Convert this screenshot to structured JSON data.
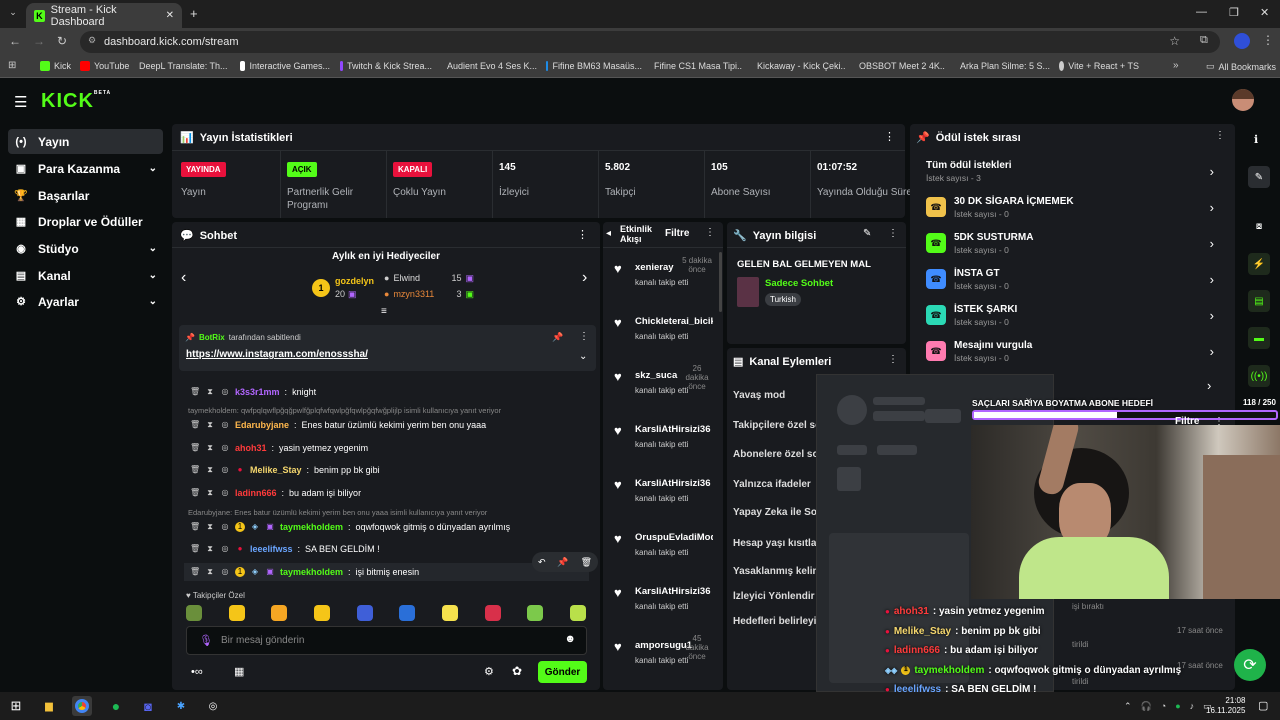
{
  "browser": {
    "tab_title": "Stream - Kick Dashboard",
    "url": "dashboard.kick.com/stream",
    "bookmarks": [
      "Kick",
      "YouTube",
      "DeepL Translate: Th...",
      "Interactive Games...",
      "Twitch & Kick Strea...",
      "Audient Evo 4 Ses K...",
      "Fifine BM63 Masaüs...",
      "Fifine CS1 Masa Tipi...",
      "Kickaway - Kick Çeki...",
      "OBSBOT Meet 2 4K...",
      "Arka Plan Silme: 5 S...",
      "Vite + React + TS"
    ],
    "all_bookmarks": "All Bookmarks"
  },
  "kick": {
    "logo": "KICK",
    "beta": "BETA"
  },
  "nav": [
    {
      "label": "Yayın",
      "icon": "(•)"
    },
    {
      "label": "Para Kazanma",
      "icon": "▣"
    },
    {
      "label": "Başarılar",
      "icon": "🏆"
    },
    {
      "label": "Droplar ve Ödüller",
      "icon": "▦"
    },
    {
      "label": "Stüdyo",
      "icon": "◉"
    },
    {
      "label": "Kanal",
      "icon": "▤"
    },
    {
      "label": "Ayarlar",
      "icon": "⚙"
    }
  ],
  "stats": {
    "title": "Yayın İstatistikleri",
    "items": [
      {
        "badge": "YAYINDA",
        "badge_color": "#e9113c",
        "label": "Yayın"
      },
      {
        "badge": "AÇIK",
        "badge_color": "#53fc18",
        "label": "Partnerlik Gelir Programı"
      },
      {
        "badge": "KAPALI",
        "badge_color": "#e9113c",
        "label": "Çoklu Yayın"
      },
      {
        "value": "145",
        "label": "İzleyici"
      },
      {
        "value": "5.802",
        "label": "Takipçi"
      },
      {
        "value": "105",
        "label": "Abone Sayısı"
      },
      {
        "value": "01:07:52",
        "label": "Yayında Olduğu Süre"
      }
    ]
  },
  "chat": {
    "title": "Sohbet",
    "gifters_title": "Aylık en iyi Hediyeciler",
    "top_gifter": {
      "name": "gozdelyn",
      "count": "20"
    },
    "gifters": [
      {
        "name": "Elwind",
        "count": "15"
      },
      {
        "name": "mzyn3311",
        "count": "3"
      }
    ],
    "pinned_by": "BotRix",
    "pinned_suffix": "tarafından sabitlendi",
    "pinned_link": "https://www.instagram.com/enosssha/",
    "messages": [
      {
        "user": "k3s3r1mm",
        "color": "#b266ff",
        "text": "knight"
      },
      {
        "reply": "taymekholdem: qwfpqlqwflpğqğpwlfğplqfwfqwlpğfqwlpğqfwğplijlp isimli kullanıcıya yanıt veriyor"
      },
      {
        "user": "Edarubyjane",
        "color": "#ffb84d",
        "text": "Enes batur üzümlü kekimi yerim ben onu yaaa"
      },
      {
        "user": "ahoh31",
        "color": "#ff3b3b",
        "text": "yasin yetmez yegenim"
      },
      {
        "user": "Melike_Stay",
        "color": "#f5d76e",
        "text": "benim pp bk gibi"
      },
      {
        "user": "ladinn666",
        "color": "#ff3b3b",
        "text": "bu adam işi biliyor"
      },
      {
        "reply": "Edarubyjane: Enes batur üzümlü kekimi yerim ben onu yaaa isimli kullanıcıya yanıt veriyor"
      },
      {
        "user": "taymekholdem",
        "color": "#53fc18",
        "text": "oqwfoqwok gitmiş o dünyadan ayrılmış"
      },
      {
        "user": "leeelifwss",
        "color": "#6aa5ff",
        "text": "SA BEN GELDİM !"
      },
      {
        "user": "taymekholdem",
        "color": "#53fc18",
        "text": "işi bitmiş enesin"
      }
    ],
    "emote_section": "Takipçiler Özel",
    "input_placeholder": "Bir mesaj gönderin",
    "send": "Gönder"
  },
  "activity": {
    "title": "Etkinlik Akışı",
    "filter": "Filtre",
    "items": [
      {
        "name": "xenieray",
        "sub": "kanalı takip etti",
        "time": "5 dakika önce"
      },
      {
        "name": "Chickleterai_bicik",
        "sub": "kanalı takip etti",
        "time": ""
      },
      {
        "name": "skz_suca",
        "sub": "kanalı takip etti",
        "time": "26 dakika önce"
      },
      {
        "name": "KarsliAtHirsizi36",
        "sub": "kanalı takip etti",
        "time": ""
      },
      {
        "name": "KarsliAtHirsizi36",
        "sub": "kanalı takip etti",
        "time": ""
      },
      {
        "name": "OruspuEvladiMod",
        "sub": "kanalı takip etti",
        "time": ""
      },
      {
        "name": "KarsliAtHirsizi36",
        "sub": "kanalı takip etti",
        "time": ""
      },
      {
        "name": "amporsugu1",
        "sub": "kanalı takip etti",
        "time": "45 dakika önce"
      }
    ]
  },
  "stream_info": {
    "title": "Yayın bilgisi",
    "stream_title": "GELEN BAL GELMEYEN MAL",
    "category": "Sadece Sohbet",
    "tag": "Turkish"
  },
  "channel_actions": {
    "title": "Kanal Eylemleri",
    "items": [
      "Yavaş mod",
      "Takipçilere özel sohbet",
      "Abonelere özel sohbet",
      "Yalnızca ifadeler",
      "Yapay Zeka ile Sohbet",
      "Hesap yaşı kısıtlaması",
      "Yasaklanmış kelimeler",
      "İzleyici Yönlendir",
      "Hedefleri belirleyin"
    ]
  },
  "rewards": {
    "title": "Ödül istek sırası",
    "items": [
      {
        "name": "Tüm ödül istekleri",
        "sub": "İstek sayısı - 3",
        "color": ""
      },
      {
        "name": "30 DK SİGARA İÇMEMEK",
        "sub": "İstek sayısı - 0",
        "color": "#f0c24b"
      },
      {
        "name": "5DK SUSTURMA",
        "sub": "İstek sayısı - 0",
        "color": "#53fc18"
      },
      {
        "name": "İNSTA GT",
        "sub": "İstek sayısı - 0",
        "color": "#3f8cff"
      },
      {
        "name": "İSTEK ŞARKI",
        "sub": "İstek sayısı - 0",
        "color": "#2bd9b5"
      },
      {
        "name": "Mesajını vurgula",
        "sub": "İstek sayısı - 0",
        "color": "#ff7bb0"
      }
    ]
  },
  "overlay": {
    "goal": "SAÇLARI SARIYA BOYATMA ABONE HEDEFİ",
    "goal_value": "118 / 250",
    "goal_progress": 0.472,
    "filter": "Filtre",
    "ghost": [
      "işi bıraktı",
      "tirildi",
      "tirildi",
      "17 saat önce",
      "17 saat önce"
    ],
    "chat": [
      {
        "user": "ahoh31",
        "color": "#ff3b3b",
        "text": ": yasin yetmez yegenim"
      },
      {
        "user": "Melike_Stay",
        "color": "#f5d76e",
        "text": ": benim pp bk gibi"
      },
      {
        "user": "ladinn666",
        "color": "#ff3b3b",
        "text": ": bu adam işi biliyor"
      },
      {
        "user": "taymekholdem",
        "color": "#53fc18",
        "text": ": oqwfoqwok gitmiş o dünyadan ayrılmış"
      },
      {
        "user": "leeelifwss",
        "color": "#6aa5ff",
        "text": ": SA BEN GELDİM !"
      },
      {
        "user": "taymekholdem",
        "color": "#53fc18",
        "text": ": işi bitmiş enesin"
      }
    ]
  },
  "taskbar": {
    "time": "21:08",
    "date": "16.11.2025"
  }
}
